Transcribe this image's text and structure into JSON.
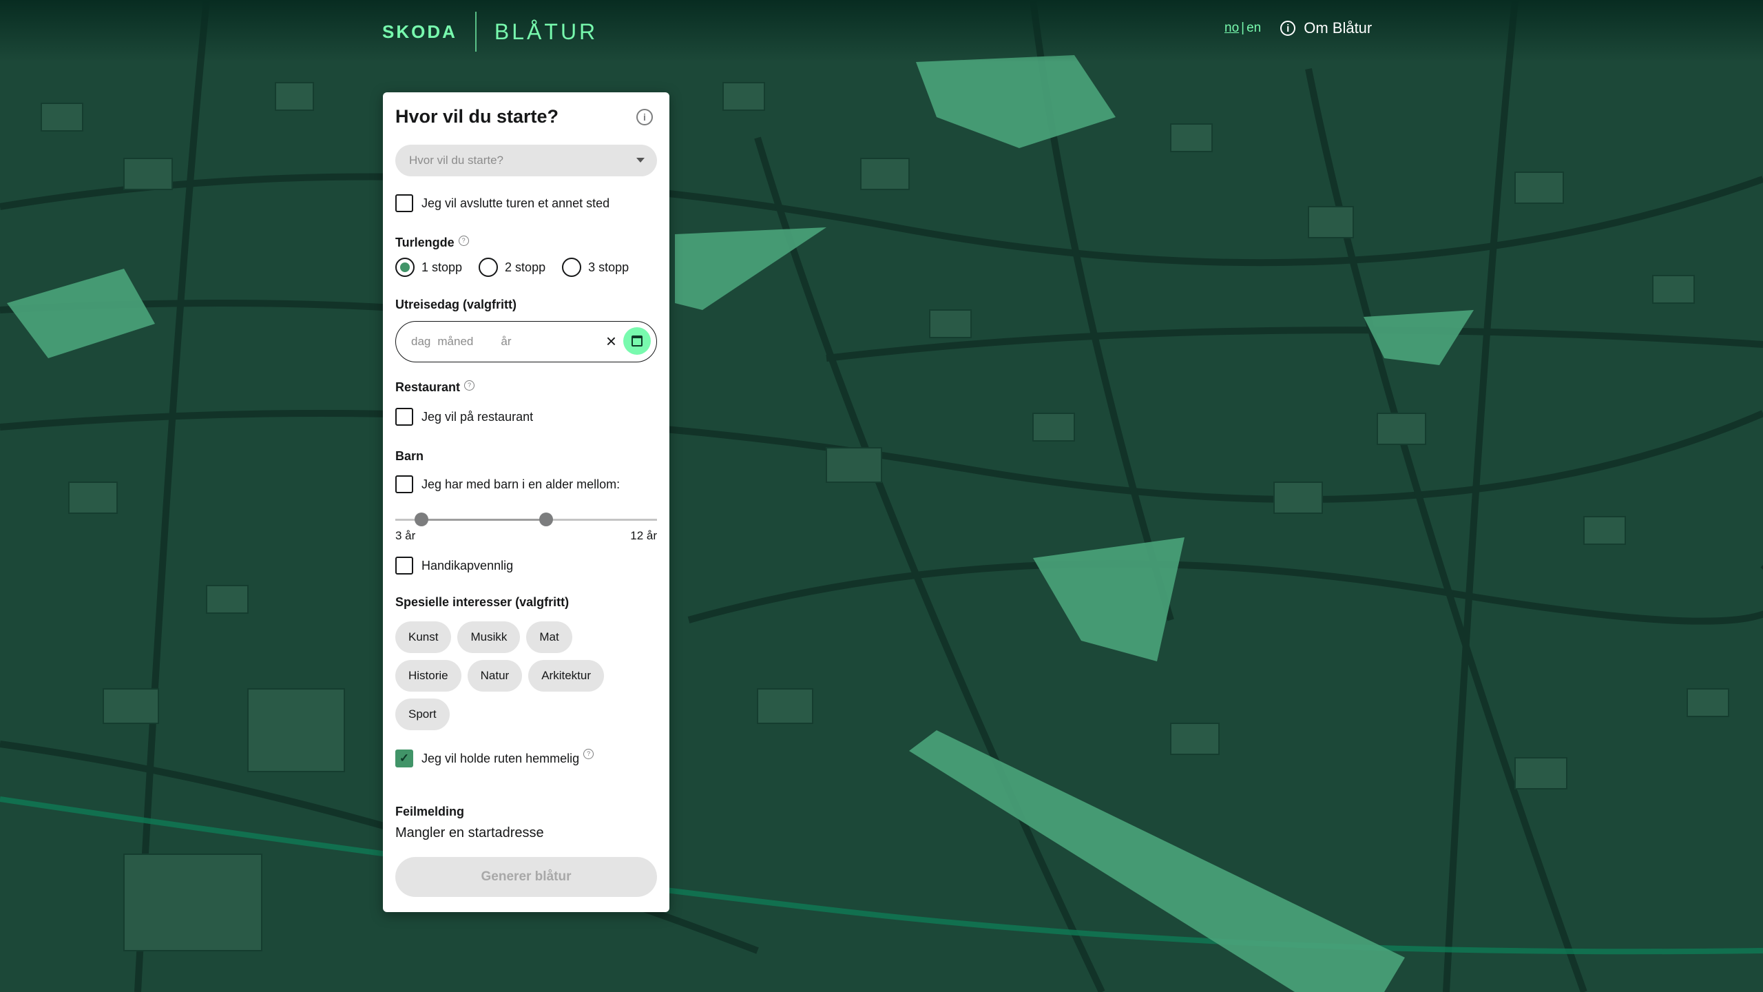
{
  "header": {
    "brand": "SKODA",
    "product": "BLÅTUR",
    "lang_no": "no",
    "lang_sep": "|",
    "lang_en": "en",
    "about": "Om Blåtur"
  },
  "form": {
    "title": "Hvor vil du starte?",
    "start_placeholder": "Hvor vil du starte?",
    "end_elsewhere": "Jeg vil avslutte turen et annet sted",
    "length_label": "Turlengde",
    "length_options": [
      "1 stopp",
      "2 stopp",
      "3 stopp"
    ],
    "length_selected": "1 stopp",
    "date_label": "Utreisedag (valgfritt)",
    "date_day": "dag",
    "date_month": "måned",
    "date_year": "år",
    "restaurant_label": "Restaurant",
    "restaurant_option": "Jeg vil på restaurant",
    "kids_label": "Barn",
    "kids_option": "Jeg har med barn i en alder mellom:",
    "kids_min": "3 år",
    "kids_max": "12 år",
    "kids_range_min": 3,
    "kids_range_max": 12,
    "accessible": "Handikapvennlig",
    "interests_label": "Spesielle interesser (valgfritt)",
    "interests": [
      [
        "Kunst",
        "Musikk",
        "Mat"
      ],
      [
        "Historie",
        "Natur",
        "Arkitektur"
      ],
      [
        "Sport"
      ]
    ],
    "secret": "Jeg vil holde ruten hemmelig",
    "secret_checked": true,
    "error_title": "Feilmelding",
    "error_text": "Mangler en startadresse",
    "submit": "Generer blåtur"
  },
  "colors": {
    "accent": "#78faae",
    "map_bg": "#1b4636",
    "check_green": "#419468"
  }
}
